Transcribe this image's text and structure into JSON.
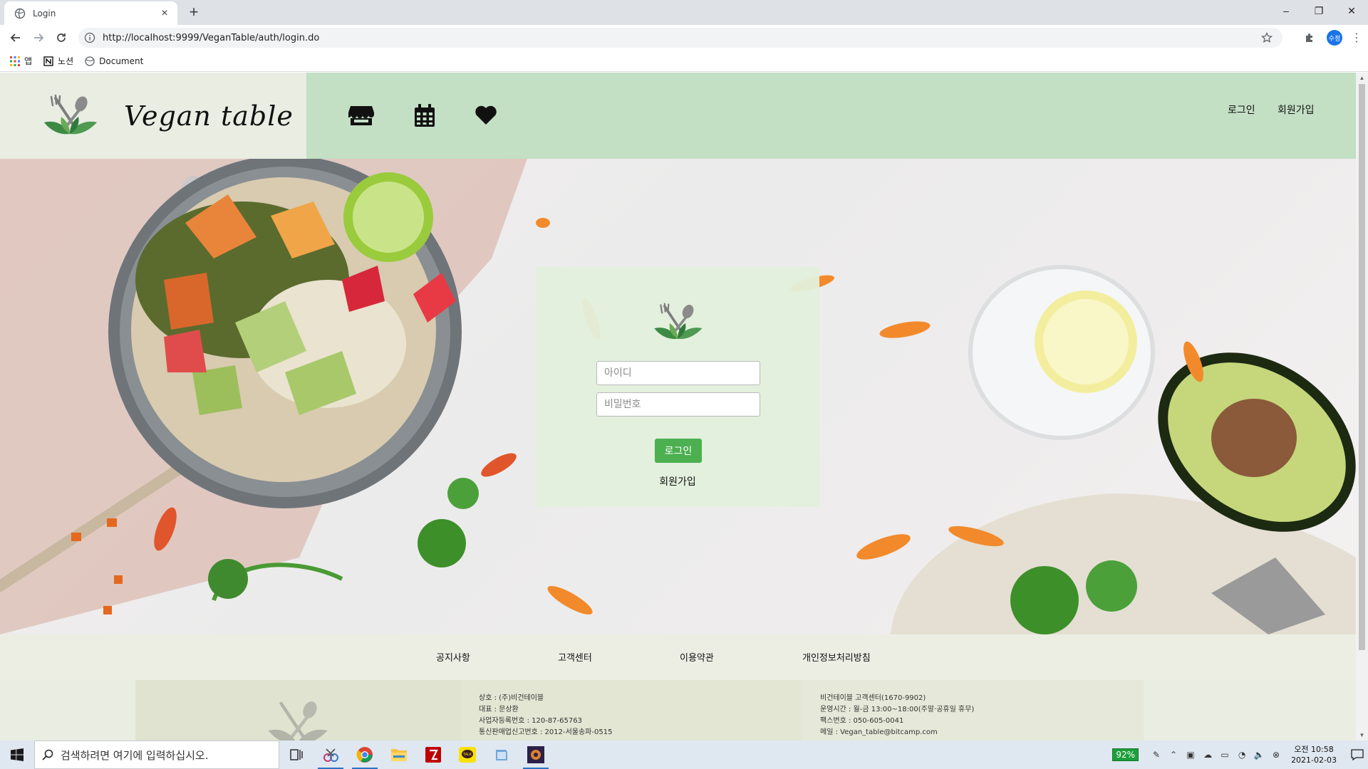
{
  "browser": {
    "tab_title": "Login",
    "url": "http://localhost:9999/VeganTable/auth/login.do",
    "profile_initials": "수정",
    "bookmarks": [
      "앱",
      "노션",
      "Document"
    ]
  },
  "site": {
    "brand_name": "Vegan table",
    "nav_links": {
      "login": "로그인",
      "signup": "회원가입"
    },
    "nav_icons": [
      "store-icon",
      "calendar-icon",
      "heart-icon"
    ]
  },
  "login_form": {
    "id_placeholder": "아이디",
    "password_placeholder": "비밀번호",
    "submit_label": "로그인",
    "signup_label": "회원가입"
  },
  "footer": {
    "links": [
      "공지사항",
      "고객센터",
      "이용약관",
      "개인정보처리방침"
    ],
    "company": [
      "상호 : (주)비건테이블",
      "대표 : 문상환",
      "사업자등록번호 : 120-87-65763",
      "통신판매업신고번호 : 2012-서울송파-0515"
    ],
    "support": [
      "비건테이블 고객센터(1670-9902)",
      "운영시간 : 월-금 13:00~18:00(주말·공휴일 휴무)",
      "팩스번호 : 050-605-0041",
      "메일 : Vegan_table@bitcamp.com"
    ]
  },
  "taskbar": {
    "search_placeholder": "검색하려면 여기에 입력하십시오.",
    "battery": "92%",
    "time": "오전 10:58",
    "date": "2021-02-03"
  },
  "colors": {
    "nav_green": "#c3dfc4",
    "brand_bg": "#e9ede2",
    "button_green": "#4caf50",
    "card_bg": "#e2f0dc"
  }
}
